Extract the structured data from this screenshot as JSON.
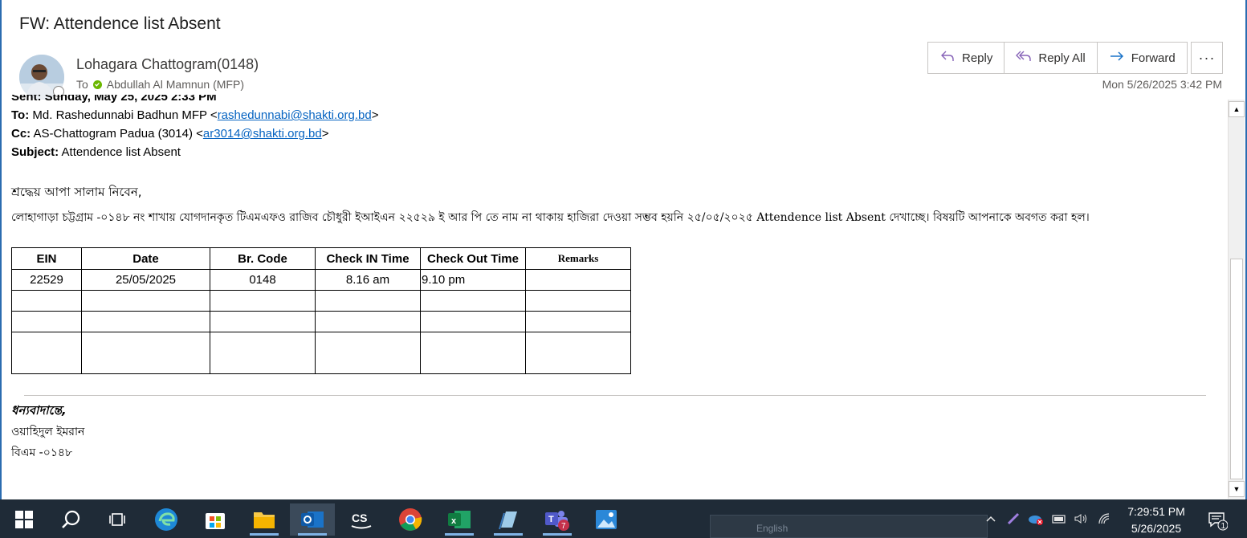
{
  "email": {
    "subject": "FW: Attendence list Absent",
    "sender": "Lohagara Chattogram(0148)",
    "to_label": "To",
    "to_name": "Abdullah Al Mamnun (MFP)",
    "date": "Mon 5/26/2025 3:42 PM",
    "actions": {
      "reply": "Reply",
      "reply_all": "Reply All",
      "forward": "Forward",
      "more": "···"
    }
  },
  "forward_header": {
    "sent_cut": "Sent: Sunday, May 25, 2025 2:33 PM",
    "to_label": "To:",
    "to_text": "Md. Rashedunnabi Badhun MFP <",
    "to_email": "rashedunnabi@shakti.org.bd",
    "to_close": ">",
    "cc_label": "Cc:",
    "cc_text": "AS-Chattogram Padua (3014) <",
    "cc_email": "ar3014@shakti.org.bd",
    "cc_close": ">",
    "subject_label": "Subject:",
    "subject_text": "Attendence list Absent"
  },
  "body": {
    "greeting": "শ্রদ্ধেয় আপা সালাম নিবেন,",
    "paragraph": "লোহাগাড়া চট্টগ্রাম -০১৪৮ নং শাখায় যোগদানকৃত টিএমএফও রাজিব চৌধুরী ইআইএন ২২৫২৯ ই আর পি তে নাম না থাকায় হাজিরা দেওয়া সম্ভব  হয়নি  ২৫/০৫/২০২৫ Attendence list Absent  দেখাচ্ছে। বিষয়টি আপনাকে অবগত করা হল।"
  },
  "table": {
    "headers": [
      "EIN",
      "Date",
      "Br. Code",
      "Check IN Time",
      "Check Out Time",
      "Remarks"
    ],
    "rows": [
      [
        "22529",
        "25/05/2025",
        "0148",
        "8.16 am",
        "9.10 pm",
        ""
      ]
    ]
  },
  "signature": {
    "line1": "ধন্যবাদান্তে,",
    "line2": "ওয়াহিদুল ইমরান",
    "line3": "বিএম -০১৪৮"
  },
  "taskbar": {
    "apps": [
      "start-icon",
      "search-icon",
      "task-view-icon",
      "edge-icon",
      "store-icon",
      "file-explorer-icon",
      "outlook-icon",
      "cs-icon",
      "chrome-icon",
      "excel-icon",
      "notepad-icon",
      "teams-icon",
      "photos-icon"
    ],
    "teams_badge": "7",
    "language": "English",
    "time": "7:29:51 PM",
    "date": "5/26/2025",
    "notification_count": "1"
  }
}
